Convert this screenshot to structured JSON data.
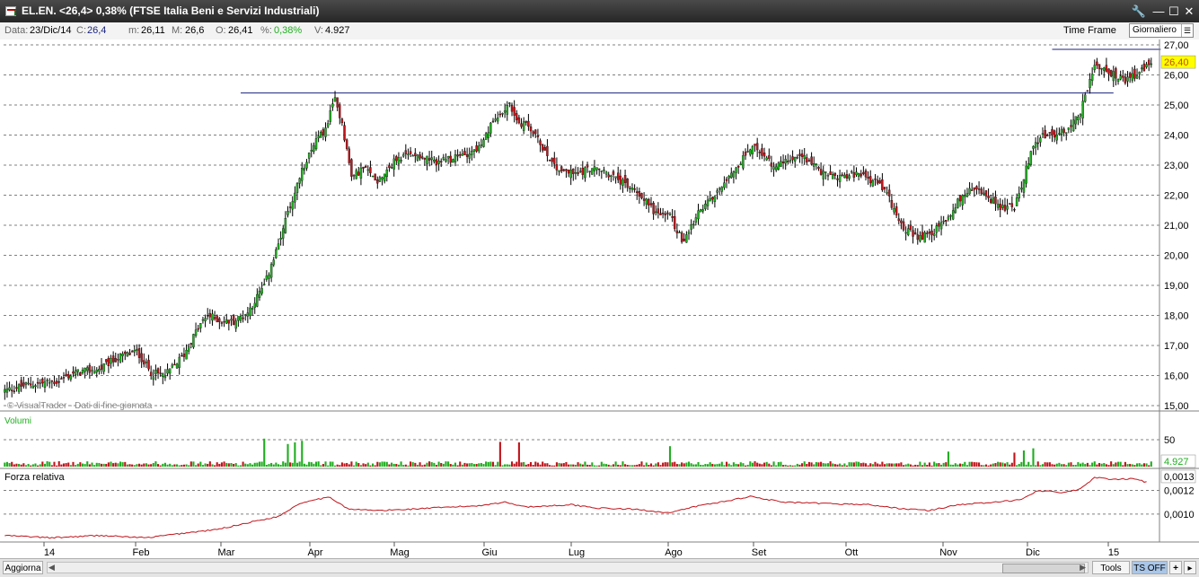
{
  "window": {
    "title": "EL.EN. <26,4> 0,38%  (FTSE Italia Beni e Servizi Industriali)",
    "buttons": {
      "tools": "🔧",
      "minimize": "—",
      "maximize": "☐",
      "close": "✕"
    }
  },
  "infobar": {
    "date_label": "Data:",
    "date_value": "23/Dic/14",
    "close_label": "C:",
    "close_value": "26,4",
    "min_label": "m:",
    "min_value": "26,11",
    "max_label": "M:",
    "max_value": "26,6",
    "open_label": "O:",
    "open_value": "26,41",
    "pct_label": "%:",
    "pct_value": "0,38%",
    "vol_label": "V:",
    "vol_value": "4.927",
    "timeframe_label": "Time Frame",
    "timeframe_value": "Giornaliero"
  },
  "colors": {
    "up": "#1fae1f",
    "down": "#c0141b",
    "trendline": "#1a237e",
    "rs_line": "#c0141b",
    "grid": "#808080",
    "last_price_bg": "#ffff00"
  },
  "chart_data": [
    {
      "type": "candlestick",
      "name": "price",
      "x_ticks": [
        "14",
        "Feb",
        "Mar",
        "Apr",
        "Mag",
        "Giu",
        "Lug",
        "Ago",
        "Set",
        "Ott",
        "Nov",
        "Dic",
        "15"
      ],
      "y_ticks": [
        "15,00",
        "16,00",
        "17,00",
        "18,00",
        "19,00",
        "20,00",
        "21,00",
        "22,00",
        "23,00",
        "24,00",
        "25,00",
        "26,00",
        "27,00"
      ],
      "ylim": [
        15,
        27
      ],
      "grid": true,
      "last_price_label": "26,40",
      "watermark": "© VisualTrader - Dati di fine giornata",
      "close_path": [
        [
          0,
          15.5
        ],
        [
          10,
          15.7
        ],
        [
          22,
          15.8
        ],
        [
          30,
          16.1
        ],
        [
          40,
          16.2
        ],
        [
          48,
          16.6
        ],
        [
          56,
          16.8
        ],
        [
          62,
          16.1
        ],
        [
          68,
          16.0
        ],
        [
          76,
          16.7
        ],
        [
          82,
          17.6
        ],
        [
          86,
          18.0
        ],
        [
          92,
          17.8
        ],
        [
          97,
          17.8
        ],
        [
          103,
          18.1
        ],
        [
          110,
          19.0
        ],
        [
          116,
          20.3
        ],
        [
          120,
          21.4
        ],
        [
          126,
          22.8
        ],
        [
          130,
          23.6
        ],
        [
          136,
          24.2
        ],
        [
          140,
          25.2
        ],
        [
          143,
          24.4
        ],
        [
          147,
          22.6
        ],
        [
          152,
          22.9
        ],
        [
          158,
          22.5
        ],
        [
          166,
          23.2
        ],
        [
          174,
          23.4
        ],
        [
          182,
          23.1
        ],
        [
          190,
          23.2
        ],
        [
          196,
          23.4
        ],
        [
          202,
          23.6
        ],
        [
          206,
          24.3
        ],
        [
          210,
          24.8
        ],
        [
          214,
          25.0
        ],
        [
          218,
          24.4
        ],
        [
          222,
          24.3
        ],
        [
          228,
          23.6
        ],
        [
          234,
          22.9
        ],
        [
          242,
          22.7
        ],
        [
          248,
          22.9
        ],
        [
          254,
          22.8
        ],
        [
          262,
          22.4
        ],
        [
          270,
          22.0
        ],
        [
          276,
          21.4
        ],
        [
          282,
          21.3
        ],
        [
          288,
          20.4
        ],
        [
          294,
          21.4
        ],
        [
          300,
          21.9
        ],
        [
          306,
          22.6
        ],
        [
          312,
          23.1
        ],
        [
          316,
          23.6
        ],
        [
          320,
          23.5
        ],
        [
          326,
          22.9
        ],
        [
          334,
          23.3
        ],
        [
          340,
          23.2
        ],
        [
          346,
          22.8
        ],
        [
          352,
          22.6
        ],
        [
          358,
          22.7
        ],
        [
          364,
          22.6
        ],
        [
          370,
          22.4
        ],
        [
          374,
          22.0
        ],
        [
          378,
          21.4
        ],
        [
          382,
          20.8
        ],
        [
          388,
          20.6
        ],
        [
          394,
          20.8
        ],
        [
          400,
          21.3
        ],
        [
          404,
          21.8
        ],
        [
          410,
          22.2
        ],
        [
          416,
          22.0
        ],
        [
          422,
          21.6
        ],
        [
          428,
          21.6
        ],
        [
          432,
          22.6
        ],
        [
          436,
          23.6
        ],
        [
          440,
          24.0
        ],
        [
          446,
          24.0
        ],
        [
          452,
          24.3
        ],
        [
          456,
          24.8
        ],
        [
          462,
          26.3
        ],
        [
          468,
          26.1
        ],
        [
          474,
          25.8
        ],
        [
          480,
          26.0
        ],
        [
          486,
          26.4
        ]
      ],
      "trendlines": [
        {
          "from": [
            100,
            25.4
          ],
          "to": [
            470,
            25.4
          ]
        },
        {
          "from": [
            444,
            26.85
          ],
          "to": [
            490,
            26.85
          ]
        }
      ]
    },
    {
      "type": "bar",
      "name": "Volumi",
      "y_ticks": [
        "50"
      ],
      "last_value_label": "4.927",
      "spikes": [
        [
          110,
          52
        ],
        [
          120,
          42
        ],
        [
          123,
          45
        ],
        [
          126,
          48
        ],
        [
          210,
          46
        ],
        [
          218,
          45
        ],
        [
          282,
          38
        ],
        [
          400,
          28
        ],
        [
          428,
          26
        ],
        [
          432,
          30
        ],
        [
          436,
          34
        ]
      ]
    },
    {
      "type": "line",
      "name": "Forza relativa",
      "y_ticks": [
        "0,0010",
        "0,0012",
        "0,0013"
      ],
      "last_value_label": "0,0013",
      "path": [
        [
          0,
          0.00082
        ],
        [
          20,
          0.0008
        ],
        [
          40,
          0.00082
        ],
        [
          60,
          0.0008
        ],
        [
          76,
          0.00084
        ],
        [
          90,
          0.00087
        ],
        [
          106,
          0.00094
        ],
        [
          116,
          0.00098
        ],
        [
          124,
          0.00108
        ],
        [
          130,
          0.00112
        ],
        [
          138,
          0.00114
        ],
        [
          146,
          0.00104
        ],
        [
          160,
          0.00103
        ],
        [
          180,
          0.00105
        ],
        [
          200,
          0.00107
        ],
        [
          212,
          0.0011
        ],
        [
          222,
          0.00106
        ],
        [
          240,
          0.00108
        ],
        [
          252,
          0.00105
        ],
        [
          268,
          0.00104
        ],
        [
          282,
          0.00101
        ],
        [
          294,
          0.00107
        ],
        [
          306,
          0.00111
        ],
        [
          316,
          0.00115
        ],
        [
          330,
          0.0011
        ],
        [
          346,
          0.00109
        ],
        [
          366,
          0.00108
        ],
        [
          378,
          0.00105
        ],
        [
          392,
          0.00103
        ],
        [
          404,
          0.00108
        ],
        [
          420,
          0.0011
        ],
        [
          430,
          0.00112
        ],
        [
          438,
          0.0012
        ],
        [
          448,
          0.00118
        ],
        [
          456,
          0.00121
        ],
        [
          462,
          0.00131
        ],
        [
          470,
          0.00129
        ],
        [
          478,
          0.0013
        ],
        [
          484,
          0.00127
        ]
      ]
    }
  ],
  "bottombar": {
    "aggiorna": "Aggiorna",
    "tools": "Tools",
    "ts_off": "TS OFF",
    "plus": "+",
    "arrow": "▸"
  }
}
